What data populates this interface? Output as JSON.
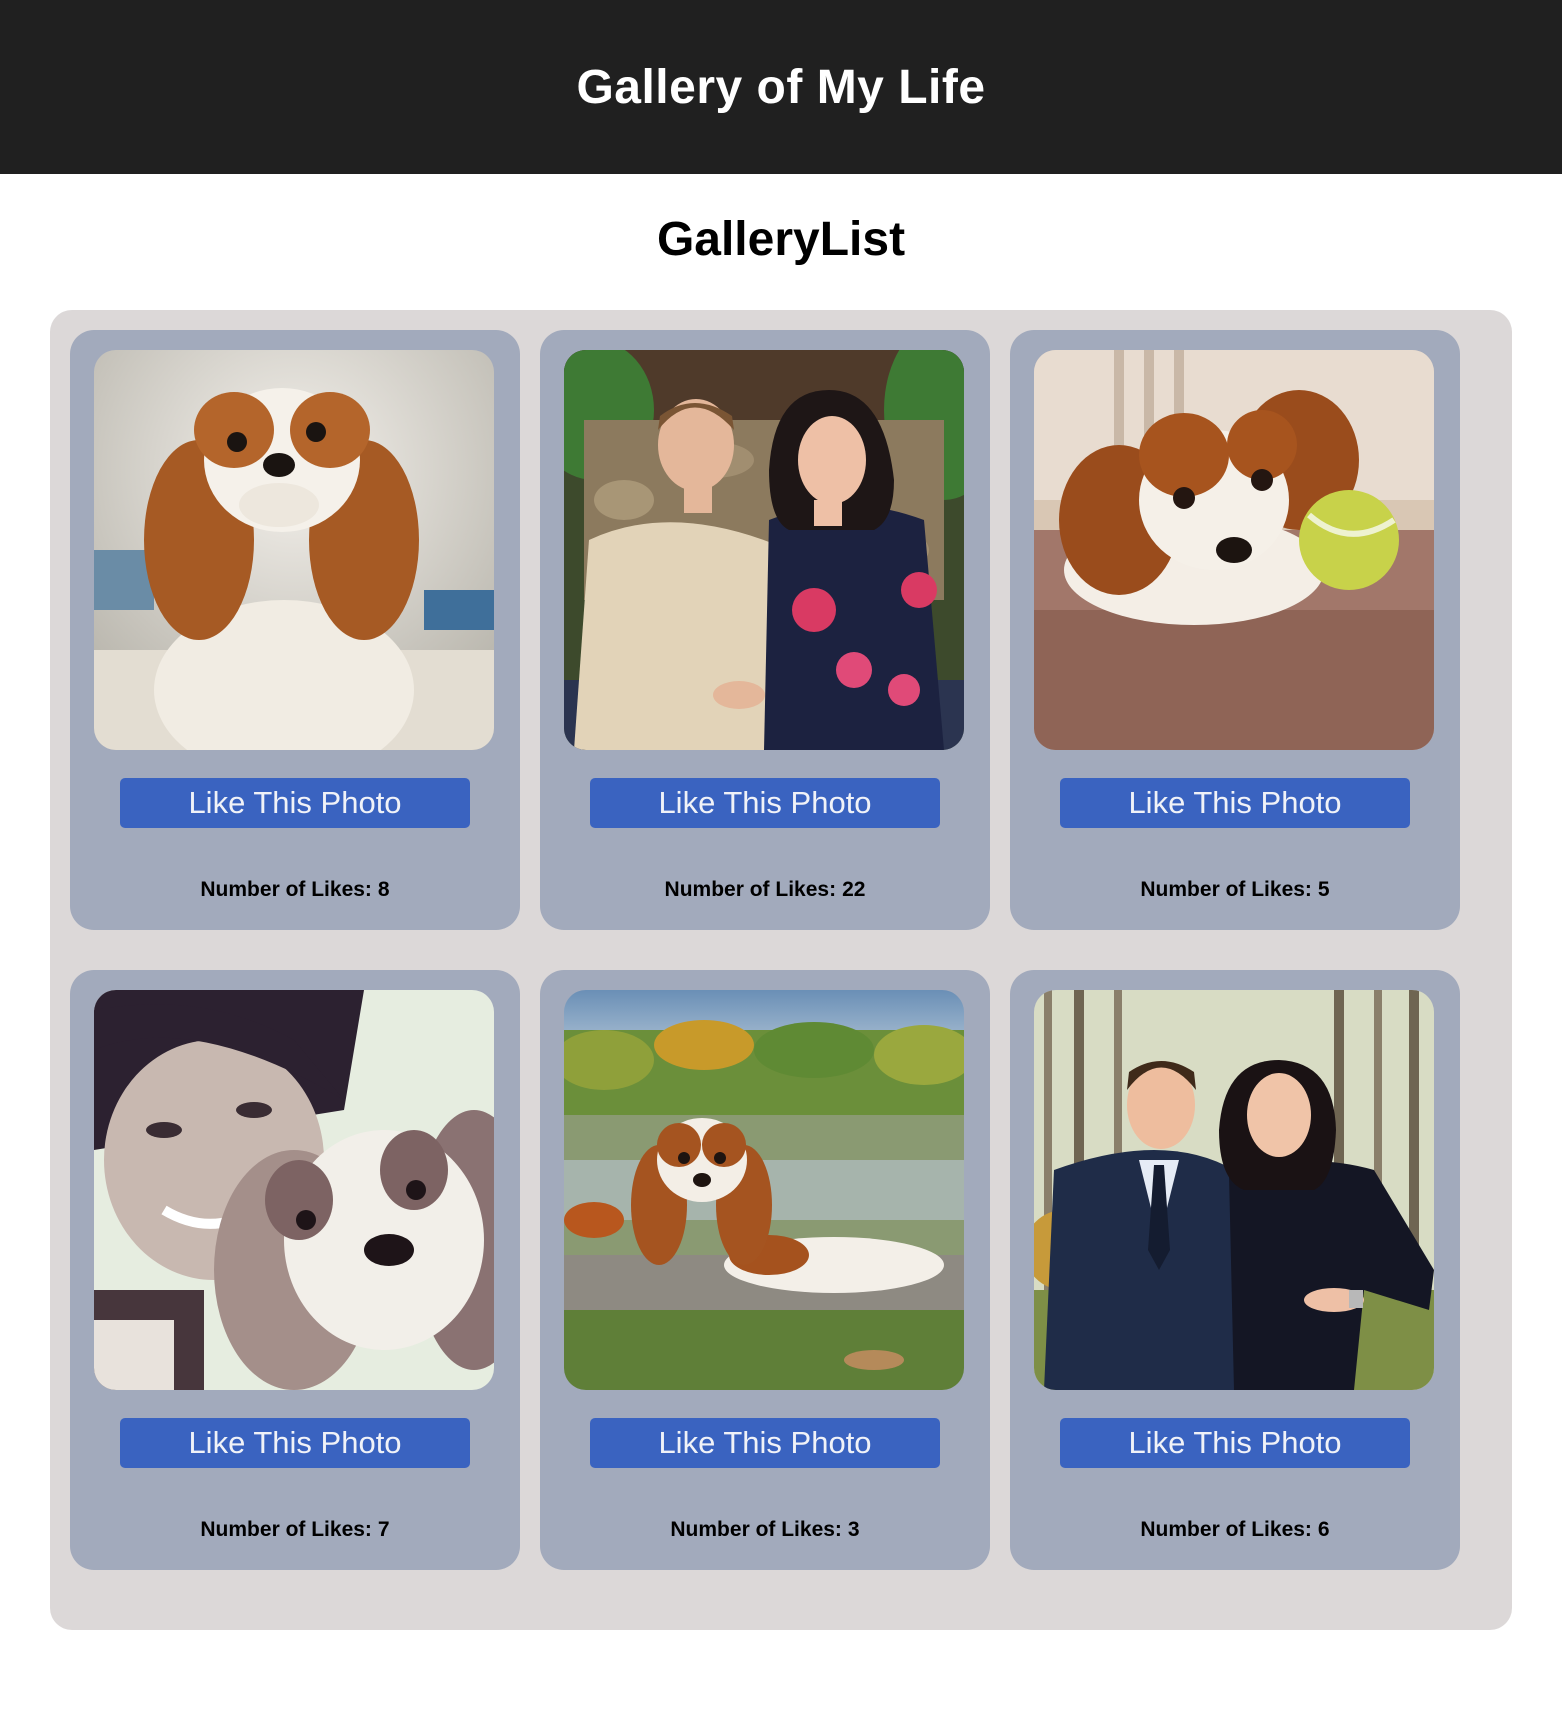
{
  "header": {
    "title": "Gallery of My Life"
  },
  "gallery": {
    "title": "GalleryList",
    "like_label": "Like This Photo",
    "likes_label": "Number of Likes:",
    "items": [
      {
        "likes": "8",
        "image_name": "cavalier-dog-portrait-image"
      },
      {
        "likes": "22",
        "image_name": "couple-garden-photo-image"
      },
      {
        "likes": "5",
        "image_name": "puppy-tennis-ball-image"
      },
      {
        "likes": "7",
        "image_name": "woman-dog-selfie-image"
      },
      {
        "likes": "3",
        "image_name": "dog-by-lake-image"
      },
      {
        "likes": "6",
        "image_name": "couple-formal-photo-image"
      }
    ]
  },
  "colors": {
    "topbar": "#202020",
    "panel": "#dcd8d8",
    "card": "#a2aabc",
    "button": "#3a63c0"
  }
}
